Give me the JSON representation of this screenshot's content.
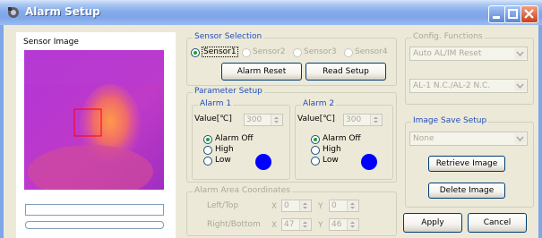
{
  "window": {
    "title": "Alarm Setup"
  },
  "left": {
    "sensor_image_label": "Sensor Image"
  },
  "sensor_selection": {
    "title": "Sensor Selection",
    "options": [
      "Sensor1",
      "Sensor2",
      "Sensor3",
      "Sensor4"
    ],
    "selected": "Sensor1",
    "alarm_reset_label": "Alarm Reset",
    "read_setup_label": "Read Setup"
  },
  "parameter_setup": {
    "title": "Parameter Setup",
    "alarm1": {
      "title": "Alarm 1",
      "value_label": "Value[℃]",
      "value": "300",
      "options": [
        "Alarm Off",
        "High",
        "Low"
      ],
      "selected": "Alarm Off",
      "indicator_color": "#0000ff"
    },
    "alarm2": {
      "title": "Alarm 2",
      "value_label": "Value[℃]",
      "value": "300",
      "options": [
        "Alarm Off",
        "High",
        "Low"
      ],
      "selected": "Alarm Off",
      "indicator_color": "#0000ff"
    }
  },
  "alarm_area": {
    "title": "Alarm Area Coordinates",
    "left_top_label": "Left/Top",
    "right_bottom_label": "Right/Bottom",
    "x_label": "X",
    "y_label": "Y",
    "left": "0",
    "top": "0",
    "right": "47",
    "bottom": "46"
  },
  "config_functions": {
    "title": "Config. Functions",
    "auto_mode": "Auto AL/IM Reset",
    "relay_mode": "AL-1 N.C./AL-2 N.C."
  },
  "image_save": {
    "title": "Image Save Setup",
    "mode": "None",
    "retrieve_label": "Retrieve Image",
    "delete_label": "Delete Image"
  },
  "footer": {
    "apply_label": "Apply",
    "cancel_label": "Cancel"
  },
  "colors": {
    "title_bar": "#86acea",
    "group_title": "#1f4ebc",
    "indicator": "#0000ff"
  }
}
